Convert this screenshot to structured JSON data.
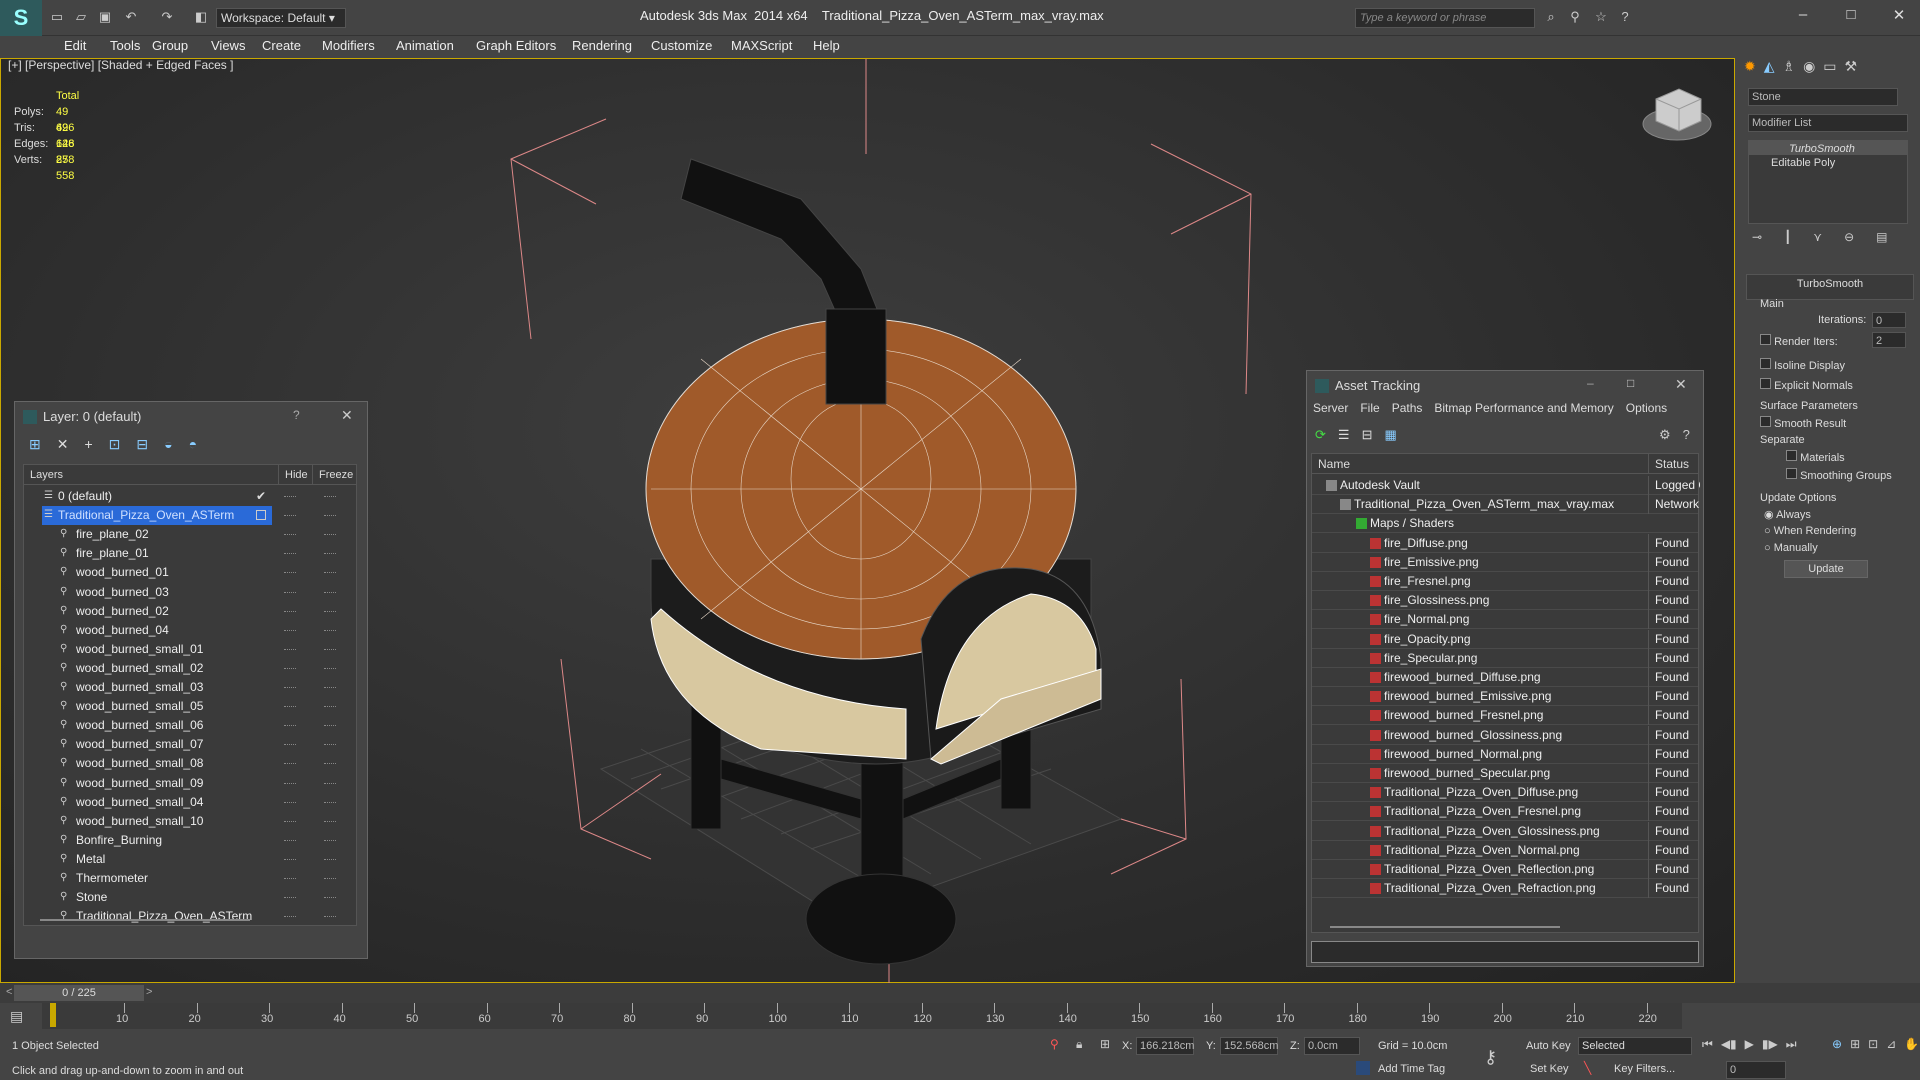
{
  "app": {
    "name": "Autodesk 3ds Max  2014 x64",
    "file": "Traditional_Pizza_Oven_ASTerm_max_vray.max",
    "workspace": "Workspace: Default",
    "search_placeholder": "Type a keyword or phrase"
  },
  "menu": [
    "Edit",
    "Tools",
    "Group",
    "Views",
    "Create",
    "Modifiers",
    "Animation",
    "Graph Editors",
    "Rendering",
    "Customize",
    "MAXScript",
    "Help"
  ],
  "viewport": {
    "label": "[+] [Perspective] [Shaded + Edged Faces ]",
    "stats": {
      "header": "Total",
      "rows": [
        {
          "k": "Polys:",
          "v": "49 626"
        },
        {
          "k": "Tris:",
          "v": "49 626"
        },
        {
          "k": "Edges:",
          "v": "148 878"
        },
        {
          "k": "Verts:",
          "v": "25 558"
        }
      ]
    }
  },
  "command_panel": {
    "object_name": "Stone",
    "modifier_list": "Modifier List",
    "stack": [
      "TurboSmooth",
      "Editable Poly"
    ],
    "rollout": "TurboSmooth",
    "main": "Main",
    "iterations_label": "Iterations:",
    "iterations": "0",
    "render_iters_label": "Render Iters:",
    "render_iters": "2",
    "isoline": "Isoline Display",
    "explicit": "Explicit Normals",
    "surface": "Surface Parameters",
    "smooth": "Smooth Result",
    "separate": "Separate",
    "materials": "Materials",
    "smoothing": "Smoothing Groups",
    "update_opts": "Update Options",
    "always": "Always",
    "when_rendering": "When Rendering",
    "manually": "Manually",
    "update": "Update"
  },
  "layer_window": {
    "title": "Layer: 0 (default)",
    "q": "?",
    "col_layers": "Layers",
    "col_hide": "Hide",
    "col_freeze": "Freeze",
    "rows": [
      "0 (default)",
      "Traditional_Pizza_Oven_ASTerm",
      "fire_plane_02",
      "fire_plane_01",
      "wood_burned_01",
      "wood_burned_03",
      "wood_burned_02",
      "wood_burned_04",
      "wood_burned_small_01",
      "wood_burned_small_02",
      "wood_burned_small_03",
      "wood_burned_small_05",
      "wood_burned_small_06",
      "wood_burned_small_07",
      "wood_burned_small_08",
      "wood_burned_small_09",
      "wood_burned_small_04",
      "wood_burned_small_10",
      "Bonfire_Burning",
      "Metal",
      "Thermometer",
      "Stone",
      "Traditional_Pizza_Oven_ASTerm"
    ]
  },
  "asset_window": {
    "title": "Asset Tracking",
    "menu": [
      "Server",
      "File",
      "Paths",
      "Bitmap Performance and Memory",
      "Options"
    ],
    "col_name": "Name",
    "col_status": "Status",
    "rows": [
      {
        "n": "Autodesk Vault",
        "s": "Logged C"
      },
      {
        "n": "Traditional_Pizza_Oven_ASTerm_max_vray.max",
        "s": "Network"
      },
      {
        "n": "Maps / Shaders",
        "s": ""
      },
      {
        "n": "fire_Diffuse.png",
        "s": "Found"
      },
      {
        "n": "fire_Emissive.png",
        "s": "Found"
      },
      {
        "n": "fire_Fresnel.png",
        "s": "Found"
      },
      {
        "n": "fire_Glossiness.png",
        "s": "Found"
      },
      {
        "n": "fire_Normal.png",
        "s": "Found"
      },
      {
        "n": "fire_Opacity.png",
        "s": "Found"
      },
      {
        "n": "fire_Specular.png",
        "s": "Found"
      },
      {
        "n": "firewood_burned_Diffuse.png",
        "s": "Found"
      },
      {
        "n": "firewood_burned_Emissive.png",
        "s": "Found"
      },
      {
        "n": "firewood_burned_Fresnel.png",
        "s": "Found"
      },
      {
        "n": "firewood_burned_Glossiness.png",
        "s": "Found"
      },
      {
        "n": "firewood_burned_Normal.png",
        "s": "Found"
      },
      {
        "n": "firewood_burned_Specular.png",
        "s": "Found"
      },
      {
        "n": "Traditional_Pizza_Oven_Diffuse.png",
        "s": "Found"
      },
      {
        "n": "Traditional_Pizza_Oven_Fresnel.png",
        "s": "Found"
      },
      {
        "n": "Traditional_Pizza_Oven_Glossiness.png",
        "s": "Found"
      },
      {
        "n": "Traditional_Pizza_Oven_Normal.png",
        "s": "Found"
      },
      {
        "n": "Traditional_Pizza_Oven_Reflection.png",
        "s": "Found"
      },
      {
        "n": "Traditional_Pizza_Oven_Refraction.png",
        "s": "Found"
      }
    ]
  },
  "timeline": {
    "frame": "0 / 225",
    "ticks": [
      "10",
      "20",
      "30",
      "40",
      "50",
      "60",
      "70",
      "80",
      "90",
      "100",
      "110",
      "120",
      "130",
      "140",
      "150",
      "160",
      "170",
      "180",
      "190",
      "200",
      "210",
      "220"
    ]
  },
  "status": {
    "selected": "1 Object Selected",
    "hint": "Click and drag up-and-down to zoom in and out",
    "x_label": "X:",
    "x": "166.218cm",
    "y_label": "Y:",
    "y": "152.568cm",
    "z_label": "Z:",
    "z": "0.0cm",
    "grid": "Grid = 10.0cm",
    "autokey": "Auto Key",
    "setkey": "Set Key",
    "selected_opt": "Selected",
    "key_filters": "Key Filters...",
    "add_time_tag": "Add Time Tag",
    "frame_field": "0"
  }
}
